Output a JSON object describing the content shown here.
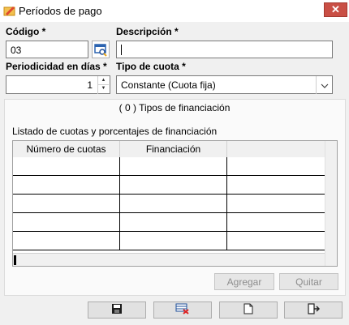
{
  "window": {
    "title": "Períodos de pago",
    "close_glyph": "✕"
  },
  "form": {
    "codigo_label": "Código *",
    "codigo_value": "03",
    "descripcion_label": "Descripción *",
    "descripcion_value": "",
    "periodicidad_label": "Periodicidad en días *",
    "periodicidad_value": "1",
    "tipo_cuota_label": "Tipo de cuota *",
    "tipo_cuota_value": "Constante (Cuota fija)"
  },
  "financing": {
    "title": "( 0 ) Tipos de financiación",
    "list_label": "Listado de cuotas y porcentajes de financiación",
    "columns": [
      "Número de cuotas",
      "Financiación"
    ],
    "empty_rows": 5,
    "agregar_label": "Agregar",
    "quitar_label": "Quitar"
  },
  "toolbar": {
    "buttons": [
      "save-icon",
      "delete-icon",
      "new-document-icon",
      "exit-icon"
    ]
  },
  "colors": {
    "close_button": "#c94f45",
    "client_background": "#f0f0f0",
    "disabled_text": "#8d8d8d"
  }
}
